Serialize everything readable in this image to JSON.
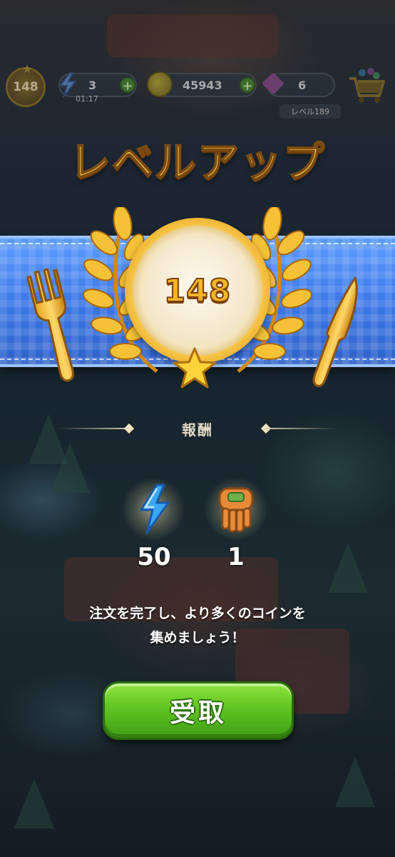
{
  "hud": {
    "player_level": "148",
    "energy": "3",
    "energy_timer": "01:17",
    "coins": "45943",
    "gems": "6",
    "next_level_label": "レベル189"
  },
  "popup": {
    "title": "レベルアップ",
    "level_number": "148",
    "reward_label": "報酬",
    "rewards": [
      {
        "icon": "energy-bolt-icon",
        "value": "50"
      },
      {
        "icon": "gloves-icon",
        "value": "1"
      }
    ],
    "message_line1": "注文を完了し、より多くのコインを",
    "message_line2": "集めましょう！",
    "claim_button": "受取"
  },
  "colors": {
    "title_gold": "#f8ca4c",
    "banner_blue": "#3d78e8",
    "button_green": "#62c422"
  }
}
